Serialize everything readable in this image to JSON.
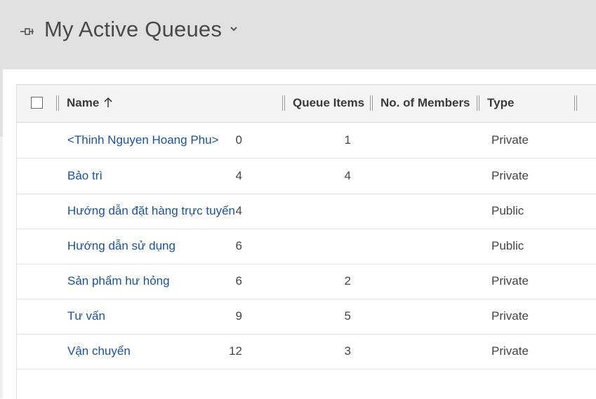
{
  "header": {
    "title": "My Active Queues"
  },
  "grid": {
    "columns": {
      "name": "Name",
      "queue_items": "Queue Items",
      "members": "No. of Members",
      "type": "Type"
    },
    "rows": [
      {
        "name": "<Thinh Nguyen Hoang Phu>",
        "queue_items": "0",
        "members": "1",
        "type": "Private"
      },
      {
        "name": "Bảo trì",
        "queue_items": "4",
        "members": "4",
        "type": "Private"
      },
      {
        "name": "Hướng dẫn đặt hàng trực tuyến",
        "queue_items": "4",
        "members": "",
        "type": "Public"
      },
      {
        "name": "Hướng dẫn sử dụng",
        "queue_items": "6",
        "members": "",
        "type": "Public"
      },
      {
        "name": "Sản phẩm hư hỏng",
        "queue_items": "6",
        "members": "2",
        "type": "Private"
      },
      {
        "name": "Tư vấn",
        "queue_items": "9",
        "members": "5",
        "type": "Private"
      },
      {
        "name": "Vận chuyển",
        "queue_items": "12",
        "members": "3",
        "type": "Private"
      }
    ]
  },
  "icons": {
    "pin": "pin-icon",
    "dropdown": "chevron-down-icon",
    "sort": "sort-ascending-arrow-icon"
  },
  "colors": {
    "header_bg": "#e1e1e1",
    "link": "#1c5196"
  }
}
